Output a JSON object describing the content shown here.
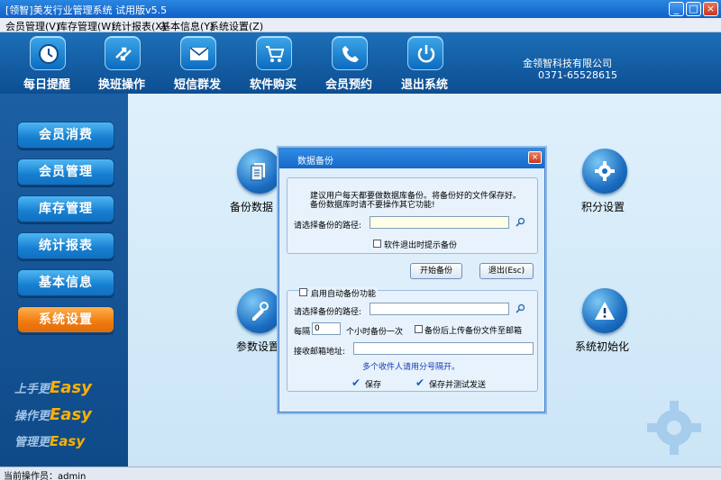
{
  "window": {
    "title": "[领智]美发行业管理系统 试用版v5.5",
    "minimize": "_",
    "maximize": "□",
    "close": "×"
  },
  "menu": [
    "会员管理(V)",
    "库存管理(W)",
    "统计报表(X)",
    "基本信息(Y)",
    "系统设置(Z)"
  ],
  "toolbar": {
    "items": [
      {
        "label": "每日提醒",
        "icon": "clock-icon"
      },
      {
        "label": "换班操作",
        "icon": "switch-arrows-icon"
      },
      {
        "label": "短信群发",
        "icon": "envelope-icon"
      },
      {
        "label": "软件购买",
        "icon": "shopping-cart-icon"
      },
      {
        "label": "会员预约",
        "icon": "phone-icon"
      },
      {
        "label": "退出系统",
        "icon": "power-icon"
      }
    ],
    "company": "金领智科技有限公司",
    "phone": "0371-65528615"
  },
  "sidebar": {
    "items": [
      "会员消费",
      "会员管理",
      "库存管理",
      "统计报表",
      "基本信息",
      "系统设置"
    ],
    "active": "系统设置",
    "slogans": [
      {
        "cn": "上手更",
        "en": "Easy"
      },
      {
        "cn": "操作更",
        "en": "Easy"
      },
      {
        "cn": "管理更",
        "en": "Easy"
      }
    ]
  },
  "main": {
    "backup_label": "备份数据",
    "points_label": "积分设置",
    "params_label": "参数设置",
    "init_label": "系统初始化"
  },
  "dialog": {
    "title": "数据备份",
    "close": "×",
    "tip_line1": "建议用户每天都要做数据库备份。将备份好的文件保存好。",
    "tip_line2": "备份数据库时请不要操作其它功能!",
    "path_label": "请选择备份的路径:",
    "path_value": "",
    "exit_prompt": "软件退出时提示备份",
    "start_button": "开始备份",
    "exit_button": "退出(Esc)",
    "auto_label": "启用自动备份功能",
    "auto_path_label": "请选择备份的路径:",
    "auto_path_value": "",
    "every_label": "每隔",
    "every_value": "0",
    "hours_label": "个小时备份一次",
    "upload_label": "备份后上传备份文件至邮箱",
    "email_label": "接收邮箱地址:",
    "email_value": "",
    "email_hint": "多个收件人请用分号隔开。",
    "save_button": "保存",
    "save_test_button": "保存并测试发送"
  },
  "status": {
    "text": "当前操作员：admin"
  }
}
